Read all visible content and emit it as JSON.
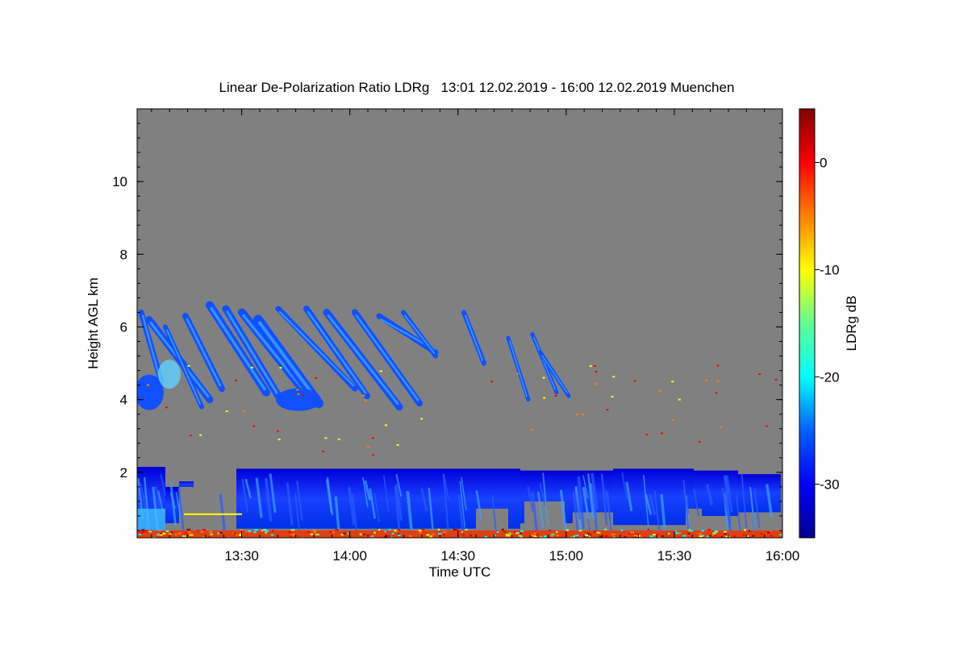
{
  "chart_data": {
    "type": "heatmap",
    "title": "Linear De-Polarization Ratio LDRg   13:01 12.02.2019 - 16:00 12.02.2019 Muenchen",
    "xlabel": "Time UTC",
    "ylabel": "Height AGL km",
    "colorbar_label": "LDRg dB",
    "xlim": [
      "13:01",
      "16:00"
    ],
    "ylim_km": [
      0.2,
      12.0
    ],
    "x_ticks": [
      "13:30",
      "14:00",
      "14:30",
      "15:00",
      "15:30",
      "16:00"
    ],
    "x_tick_minutes": [
      30,
      60,
      90,
      120,
      150,
      180
    ],
    "y_ticks": [
      "2",
      "4",
      "6",
      "8",
      "10"
    ],
    "y_tick_values": [
      2,
      4,
      6,
      8,
      10
    ],
    "colorbar_range_db": [
      -35,
      5
    ],
    "colorbar_ticks": [
      "0",
      "-10",
      "-20",
      "-30"
    ],
    "colorbar_tick_values": [
      0,
      -10,
      -20,
      -30
    ],
    "colormap": [
      "#00008f",
      "#0000ff",
      "#0080ff",
      "#00ffff",
      "#80ff80",
      "#ffff00",
      "#ff8000",
      "#ff0000",
      "#800000"
    ],
    "no_data_color": "#808080",
    "features": [
      {
        "kind": "boundary-layer",
        "time_range": [
          "13:01",
          "16:00"
        ],
        "height_km": [
          0.3,
          2.15
        ],
        "ldr_db": -30
      },
      {
        "kind": "cirrus-fallstreaks",
        "time_range": [
          "13:01",
          "15:05"
        ],
        "height_km": [
          3.6,
          6.6
        ],
        "ldr_db": -28
      },
      {
        "kind": "surface-layer",
        "time_range": [
          "13:01",
          "16:00"
        ],
        "height_km": [
          0.2,
          0.4
        ],
        "ldr_db": 0
      }
    ]
  }
}
